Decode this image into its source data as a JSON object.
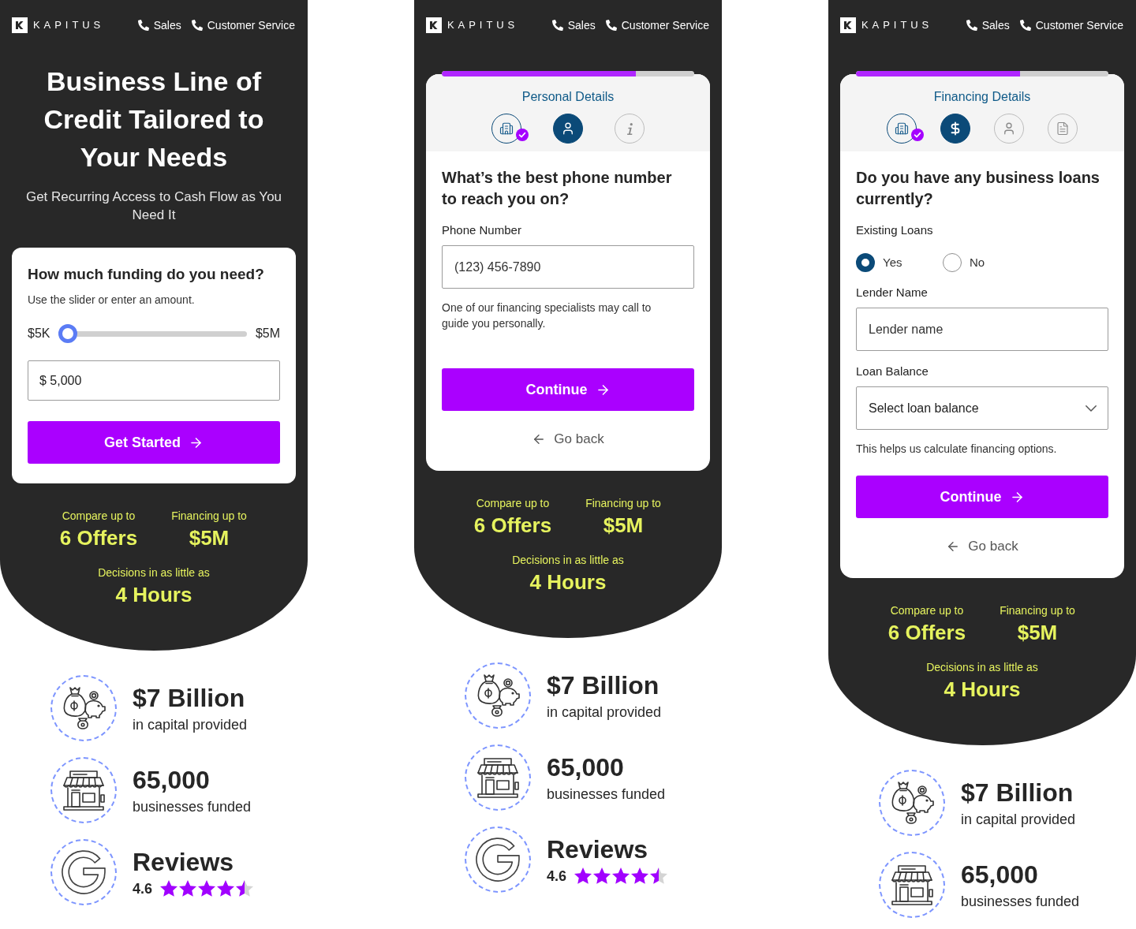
{
  "screens": [
    {
      "header": {
        "brand": "KAPITUS",
        "links": [
          {
            "label": "Sales"
          },
          {
            "label": "Customer Service"
          }
        ]
      },
      "hero": {
        "title": "Business Line of Credit Tailored to Your Needs",
        "subtitle": "Get Recurring Access to Cash Flow as You Need It"
      },
      "card": {
        "kind": "amount",
        "question": "How much funding do you need?",
        "hint": "Use the slider or enter an amount.",
        "slider": {
          "min_label": "$5K",
          "max_label": "$5M",
          "level": 0
        },
        "amount": {
          "value": "$ 5,000"
        },
        "button": "Get Started"
      },
      "highlights": [
        {
          "caption": "Compare up to",
          "value": "6 Offers"
        },
        {
          "caption": "Financing up to",
          "value": "$5M"
        },
        {
          "caption": "Decisions in as little as",
          "value": "4 Hours"
        }
      ],
      "stats": [
        {
          "kind": "figure",
          "value": "$7 Billion",
          "caption": "in capital provided"
        },
        {
          "kind": "figure",
          "value": "65,000",
          "caption": "businesses funded"
        },
        {
          "kind": "rating",
          "value": "Reviews",
          "rating": "4.6",
          "stars": 4.5
        }
      ]
    },
    {
      "header": {
        "brand": "KAPITUS",
        "links": [
          {
            "label": "Sales"
          },
          {
            "label": "Customer Service"
          }
        ]
      },
      "card": {
        "kind": "step",
        "progress": {
          "level": 0.77
        },
        "step_title": "Personal Details",
        "steps": [
          {
            "kind": "business",
            "completed": true,
            "selected": false
          },
          {
            "kind": "personal",
            "completed": false,
            "selected": true
          },
          {
            "kind": "additional",
            "completed": false,
            "selected": false
          }
        ],
        "question": "What’s the best phone number to reach you on?",
        "fields": [
          {
            "kind": "text",
            "label": "Phone Number",
            "placeholder": "(123) 456-7890"
          }
        ],
        "note": "One of our financing specialists may call to guide you personally.",
        "button": "Continue",
        "back": "Go back"
      },
      "highlights": [
        {
          "caption": "Compare up to",
          "value": "6 Offers"
        },
        {
          "caption": "Financing up to",
          "value": "$5M"
        },
        {
          "caption": "Decisions in as little as",
          "value": "4 Hours"
        }
      ],
      "stats": [
        {
          "kind": "figure",
          "value": "$7 Billion",
          "caption": "in capital provided"
        },
        {
          "kind": "figure",
          "value": "65,000",
          "caption": "businesses funded"
        },
        {
          "kind": "rating",
          "value": "Reviews",
          "rating": "4.6",
          "stars": 4.5
        }
      ]
    },
    {
      "header": {
        "brand": "KAPITUS",
        "links": [
          {
            "label": "Sales"
          },
          {
            "label": "Customer Service"
          }
        ]
      },
      "card": {
        "kind": "step",
        "progress": {
          "level": 0.65
        },
        "step_title": "Financing Details",
        "steps": [
          {
            "kind": "business",
            "completed": true,
            "selected": false
          },
          {
            "kind": "financing",
            "completed": false,
            "selected": true
          },
          {
            "kind": "personal",
            "completed": false,
            "selected": false
          },
          {
            "kind": "documents",
            "completed": false,
            "selected": false
          }
        ],
        "question": "Do you have any business loans currently?",
        "fields": [
          {
            "kind": "radio",
            "label": "Existing Loans",
            "options": [
              {
                "label": "Yes",
                "selected": true
              },
              {
                "label": "No",
                "selected": false
              }
            ]
          },
          {
            "kind": "text",
            "label": "Lender Name",
            "placeholder": "Lender name"
          },
          {
            "kind": "select",
            "label": "Loan Balance",
            "placeholder": "Select loan balance"
          }
        ],
        "note": "This helps us calculate financing options.",
        "button": "Continue",
        "back": "Go back"
      },
      "highlights": [
        {
          "caption": "Compare up to",
          "value": "6 Offers"
        },
        {
          "caption": "Financing up to",
          "value": "$5M"
        },
        {
          "caption": "Decisions in as little as",
          "value": "4 Hours"
        }
      ],
      "stats": [
        {
          "kind": "figure",
          "value": "$7 Billion",
          "caption": "in capital provided"
        },
        {
          "kind": "figure",
          "value": "65,000",
          "caption": "businesses funded"
        }
      ]
    }
  ]
}
